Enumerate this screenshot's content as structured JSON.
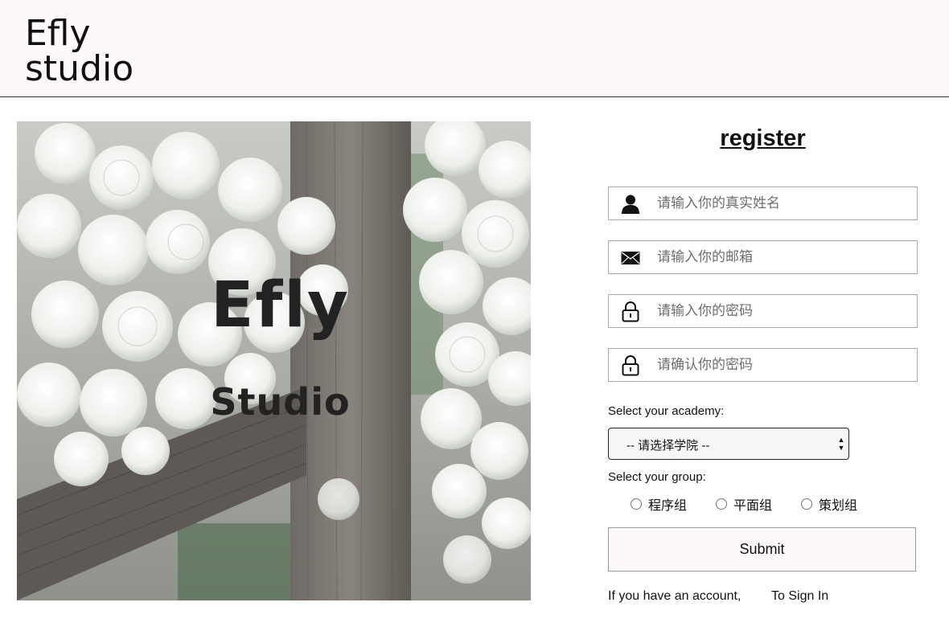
{
  "header": {
    "logo_line1": "Efly",
    "logo_line2": "studio"
  },
  "hero": {
    "title_line1": "Efly",
    "title_line2": "Studio"
  },
  "form": {
    "title": "register",
    "fields": [
      {
        "icon": "user-icon",
        "placeholder": "请输入你的真实姓名",
        "value": ""
      },
      {
        "icon": "mail-icon",
        "placeholder": "请输入你的邮箱",
        "value": ""
      },
      {
        "icon": "lock-icon",
        "placeholder": "请输入你的密码",
        "value": ""
      },
      {
        "icon": "lock-icon",
        "placeholder": "请确认你的密码",
        "value": ""
      }
    ],
    "academy_label": "Select your academy:",
    "academy_selected": "-- 请选择学院 --",
    "group_label": "Select your group:",
    "groups": [
      "程序组",
      "平面组",
      "策划组"
    ],
    "submit_label": "Submit",
    "account_prompt": "If you have an account,",
    "sign_in_link": "To Sign In"
  },
  "colors": {
    "header_bg": "#fdf9f8",
    "submit_bg": "#fdf9f8",
    "field_border": "#a9a9a9"
  }
}
